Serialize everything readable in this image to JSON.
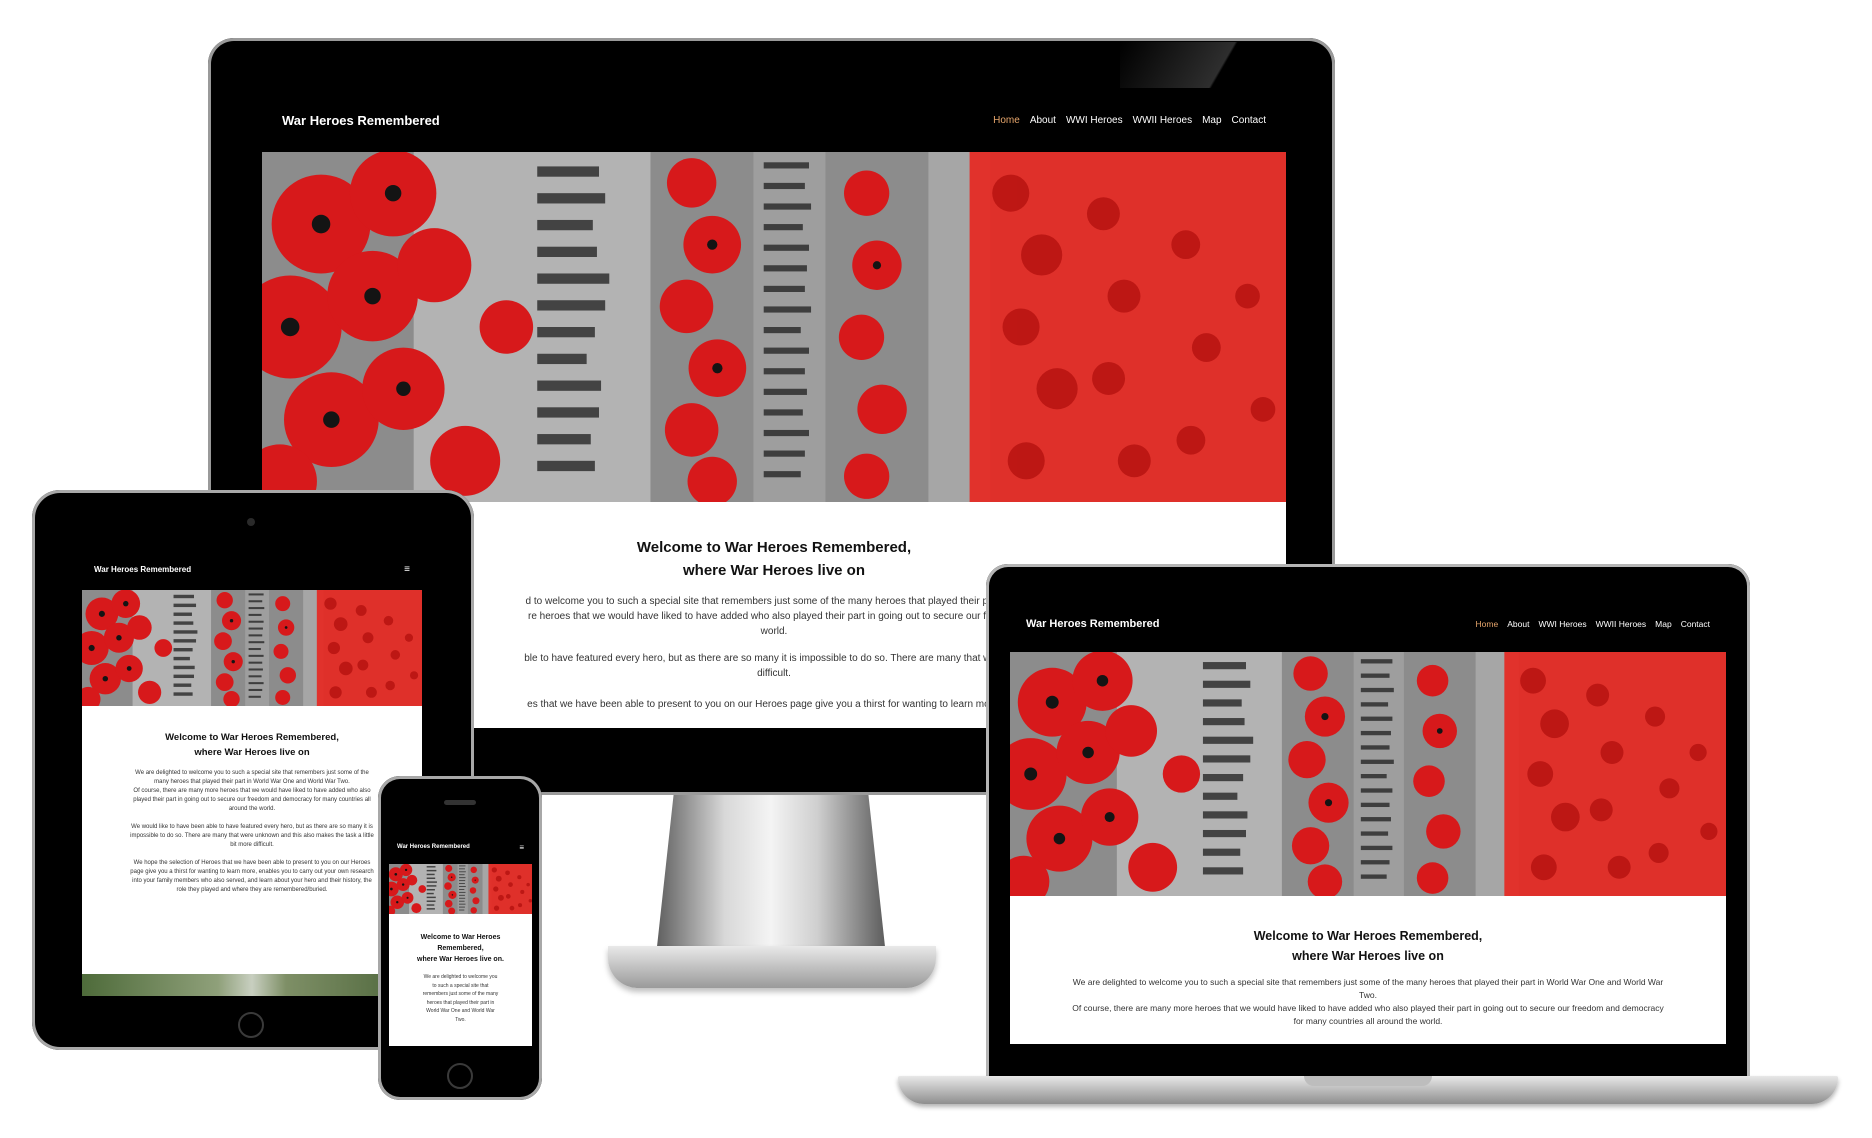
{
  "site": {
    "brand": "War Heroes Remembered",
    "nav": [
      "Home",
      "About",
      "WWI Heroes",
      "WWII Heroes",
      "Map",
      "Contact"
    ],
    "active_nav": "Home",
    "menu_icon": "≡",
    "welcome_line1": "Welcome to War Heroes Remembered,",
    "welcome_line2": "where War Heroes live on",
    "welcome_line2_phone": "where War Heroes live on.",
    "para1": "We are delighted to welcome you to such a special site that remembers just some of the many heroes that played their part in World War One and World War Two.",
    "para2": "Of course, there are many more heroes that we would have liked to have added who also played their part in going out to secure our freedom and democracy for many countries all around the world.",
    "para3": "We would like to have been able to have featured every hero, but as there are so many it is impossible to do so. There are many that were unknown and this also makes the task a little bit more difficult.",
    "para4": "We hope the selection of Heroes that we have been able to present to you on our Heroes page give you a thirst for wanting to learn more, enables you to carry out your own research into your family members who also served, and learn about your hero and their history, the role they played and where they are remembered/buried."
  },
  "monitor": {
    "para1_visible": "d to welcome you to such a special site that remembers just some of the many heroes that played their part in W",
    "para2_visible": "re heroes that we would have liked to have added who also played their part in going out to secure our freedom",
    "para2_end": "world.",
    "para3_visible": "ble to have featured every hero, but as there are so many it is impossible to do so. There are many that were unk",
    "para3_end": "difficult.",
    "para4_visible": "es that we have been able to present to you on our Heroes page give you a thirst for wanting to learn more, ena"
  },
  "phone": {
    "welcome_line1": "Welcome to War Heroes",
    "welcome_line1b": "Remembered,",
    "para1": "We are delighted to welcome you to such a special site that remembers just some of the many heroes that played their part in World War One and World War Two."
  },
  "colors": {
    "nav_bg": "#000000",
    "active_link": "#e6a56b",
    "poppy": "#d7191b"
  }
}
